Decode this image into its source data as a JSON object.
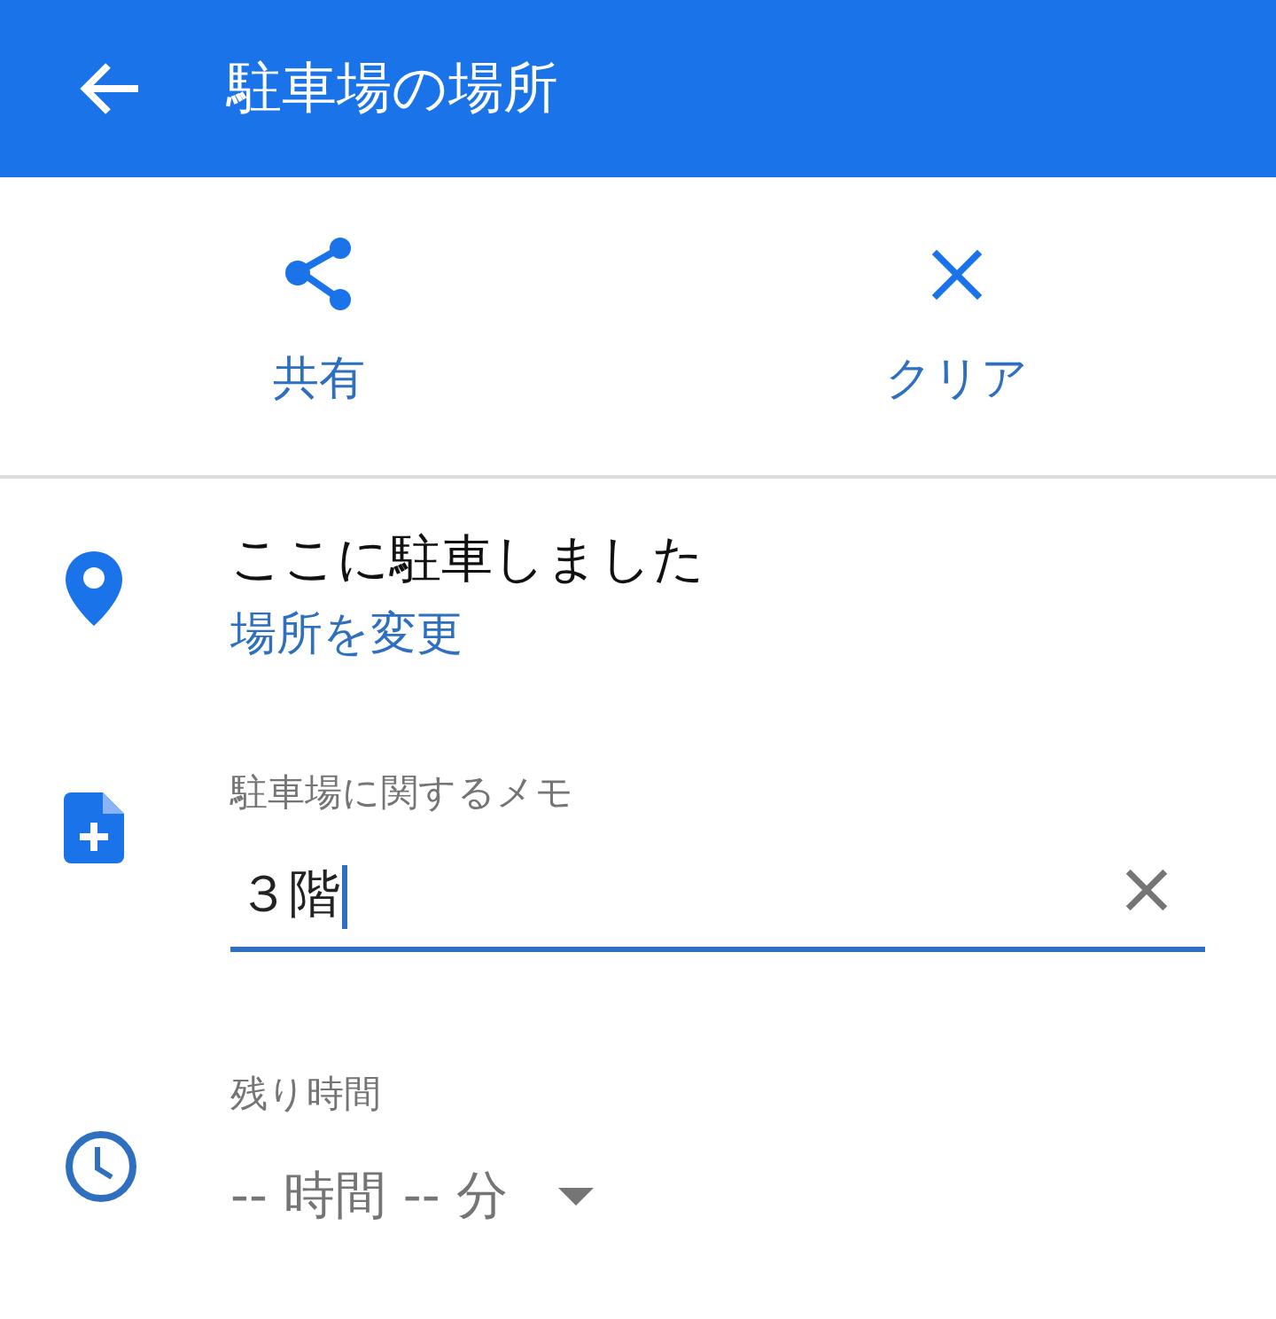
{
  "header": {
    "title": "駐車場の場所"
  },
  "actions": [
    {
      "kind": "share",
      "label": "共有"
    },
    {
      "kind": "clear",
      "label": "クリア"
    }
  ],
  "location": {
    "title": "ここに駐車しました",
    "link": "場所を変更"
  },
  "memo": {
    "label": "駐車場に関するメモ",
    "value": "３階",
    "focused": true
  },
  "timer": {
    "label": "残り時間",
    "value": "-- 時間 -- 分"
  }
}
